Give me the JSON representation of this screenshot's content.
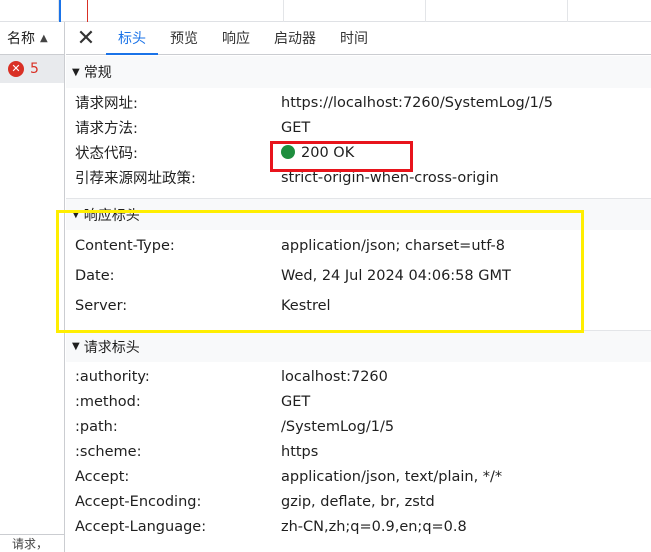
{
  "left_panel": {
    "header_label": "名称",
    "selected_request": {
      "name": "5",
      "status": "error"
    },
    "footer_text": "请求，"
  },
  "tabs": {
    "items": [
      "标头",
      "预览",
      "响应",
      "启动器",
      "时间"
    ],
    "active": "标头"
  },
  "general": {
    "title": "常规",
    "rows": [
      {
        "key": "请求网址:",
        "value": "https://localhost:7260/SystemLog/1/5"
      },
      {
        "key": "请求方法:",
        "value": "GET"
      },
      {
        "key": "状态代码:",
        "value": "200 OK"
      },
      {
        "key": "引荐来源网址政策:",
        "value": "strict-origin-when-cross-origin"
      }
    ]
  },
  "response_headers": {
    "title": "响应标头",
    "rows": [
      {
        "key": "Content-Type:",
        "value": "application/json; charset=utf-8"
      },
      {
        "key": "Date:",
        "value": "Wed, 24 Jul 2024 04:06:58 GMT"
      },
      {
        "key": "Server:",
        "value": "Kestrel"
      }
    ]
  },
  "request_headers": {
    "title": "请求标头",
    "rows": [
      {
        "key": ":authority:",
        "value": "localhost:7260"
      },
      {
        "key": ":method:",
        "value": "GET"
      },
      {
        "key": ":path:",
        "value": "/SystemLog/1/5"
      },
      {
        "key": ":scheme:",
        "value": "https"
      },
      {
        "key": "Accept:",
        "value": "application/json, text/plain, */*"
      },
      {
        "key": "Accept-Encoding:",
        "value": "gzip, deflate, br, zstd"
      },
      {
        "key": "Accept-Language:",
        "value": "zh-CN,zh;q=0.9,en;q=0.8"
      }
    ]
  },
  "colors": {
    "accent": "#1a73e8",
    "status_ok": "#1e8e3e",
    "error": "#d93025",
    "highlight_red": "#e8141c",
    "highlight_yellow": "#ffee00"
  }
}
